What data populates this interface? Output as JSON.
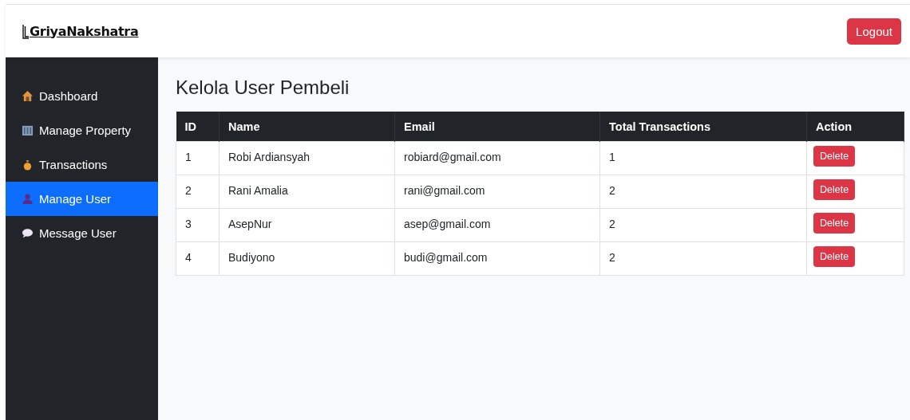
{
  "header": {
    "brand": "GriyaNakshatra",
    "logout": "Logout"
  },
  "sidebar": {
    "items": [
      {
        "label": "Dashboard",
        "selected": false
      },
      {
        "label": "Manage Property",
        "selected": false
      },
      {
        "label": "Transactions",
        "selected": false
      },
      {
        "label": "Manage User",
        "selected": true
      },
      {
        "label": "Message User",
        "selected": false
      }
    ]
  },
  "page_title": "Kelola User Pembeli",
  "table": {
    "columns": [
      "ID",
      "Name",
      "Email",
      "Total Transactions",
      "Action"
    ],
    "rows": [
      {
        "id": "1",
        "name": "Robi Ardiansyah",
        "email": "robiard@gmail.com",
        "total": "1",
        "action": "Delete"
      },
      {
        "id": "2",
        "name": "Rani Amalia",
        "email": "rani@gmail.com",
        "total": "2",
        "action": "Delete"
      },
      {
        "id": "3",
        "name": "AsepNur",
        "email": "asep@gmail.com",
        "total": "2",
        "action": "Delete"
      },
      {
        "id": "4",
        "name": "Budiyono",
        "email": "budi@gmail.com",
        "total": "2",
        "action": "Delete"
      }
    ]
  }
}
